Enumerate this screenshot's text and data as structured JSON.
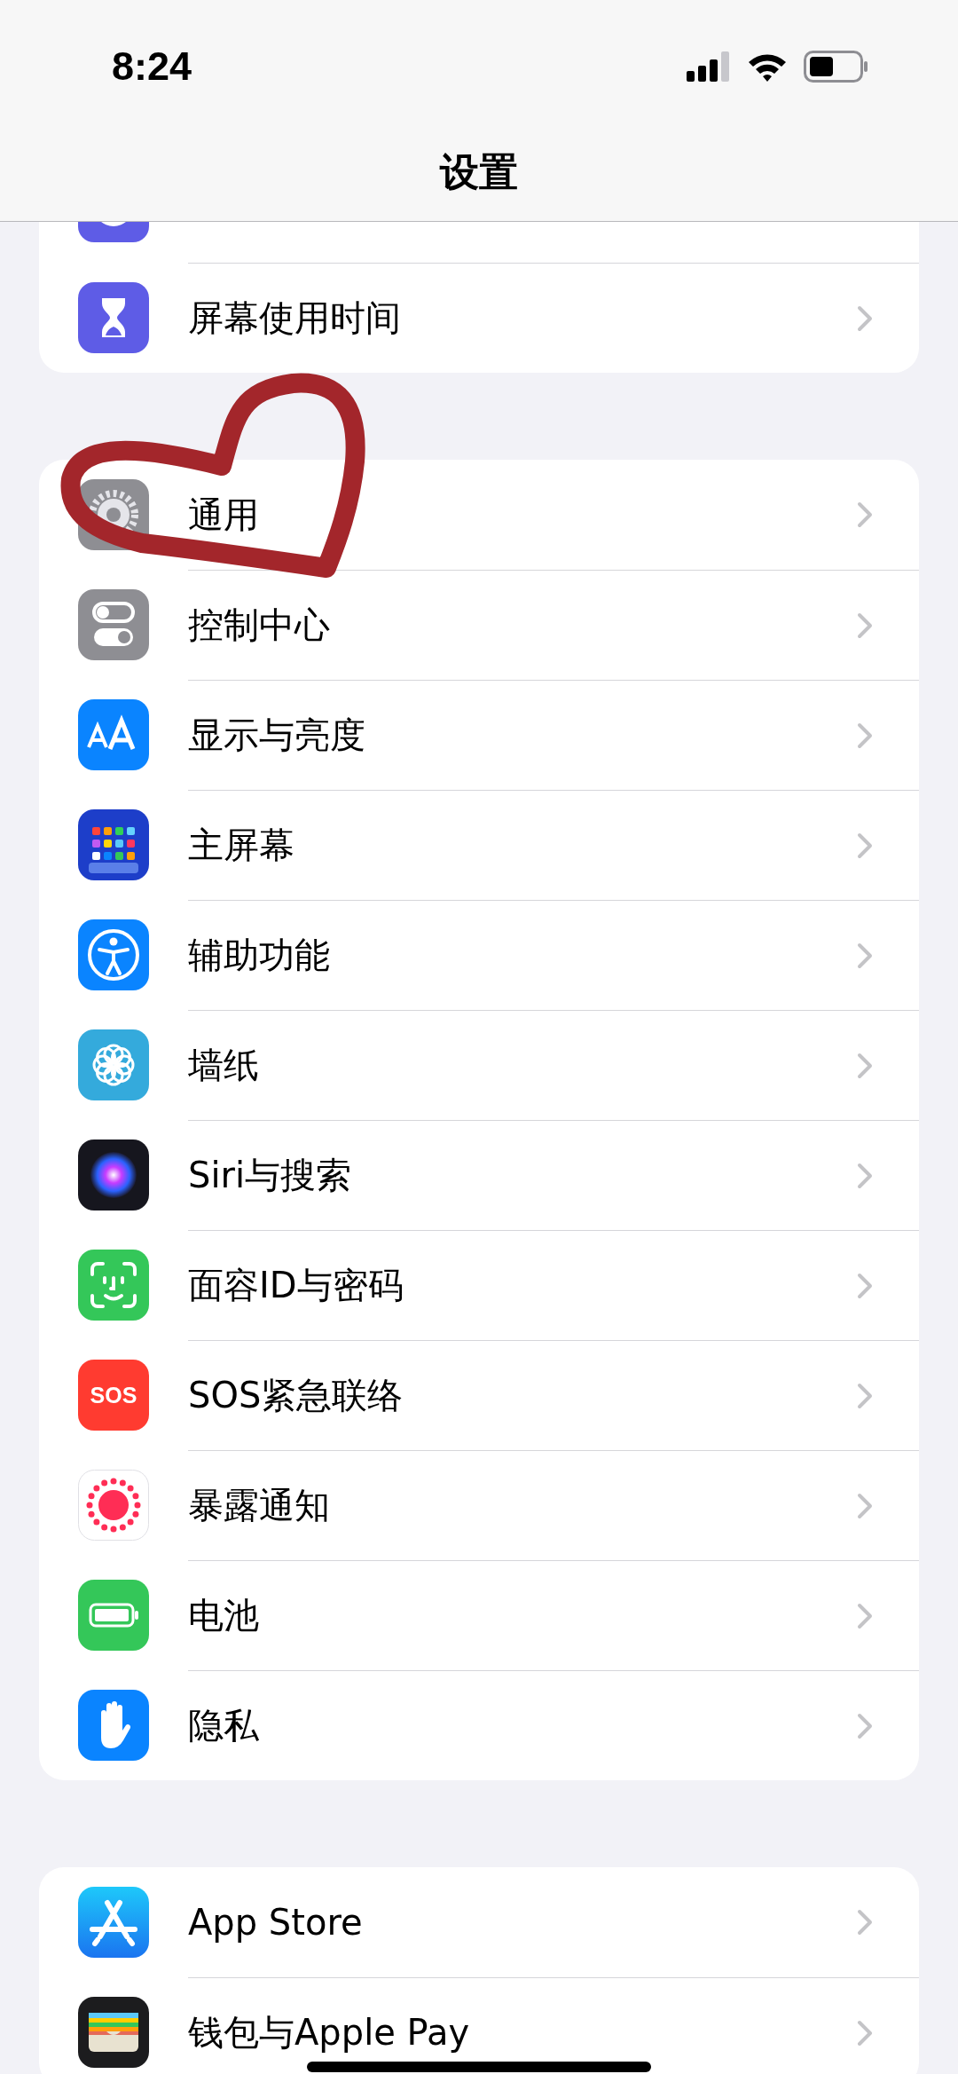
{
  "status_bar": {
    "time": "8:24"
  },
  "nav": {
    "title": "设置"
  },
  "groups": [
    {
      "rows": [
        {
          "kind": "moon",
          "cut_off": true
        },
        {
          "kind": "hourglass",
          "label": "屏幕使用时间",
          "cut_off": false
        }
      ]
    },
    {
      "rows": [
        {
          "kind": "gear",
          "label": "通用",
          "cut_off": false
        },
        {
          "kind": "toggles",
          "label": "控制中心",
          "cut_off": false
        },
        {
          "kind": "text-size",
          "label": "显示与亮度",
          "cut_off": false
        },
        {
          "kind": "home-grid",
          "label": "主屏幕",
          "cut_off": false
        },
        {
          "kind": "accessibility",
          "label": "辅助功能",
          "cut_off": false
        },
        {
          "kind": "flower",
          "label": "墙纸",
          "cut_off": false
        },
        {
          "kind": "siri",
          "label": "Siri与搜索",
          "cut_off": false
        },
        {
          "kind": "face-id",
          "label": "面容ID与密码",
          "cut_off": false
        },
        {
          "kind": "sos",
          "icon_text": "SOS",
          "label": "SOS紧急联络",
          "cut_off": false
        },
        {
          "kind": "exposure",
          "label": "暴露通知",
          "cut_off": false
        },
        {
          "kind": "battery",
          "label": "电池",
          "cut_off": false
        },
        {
          "kind": "hand",
          "label": "隐私",
          "cut_off": false
        }
      ]
    },
    {
      "rows": [
        {
          "kind": "app-store",
          "label": "App Store",
          "cut_off": false
        },
        {
          "kind": "wallet",
          "label": "钱包与Apple Pay",
          "cut_off": false
        }
      ]
    }
  ],
  "annotation": {
    "kind": "heart"
  }
}
